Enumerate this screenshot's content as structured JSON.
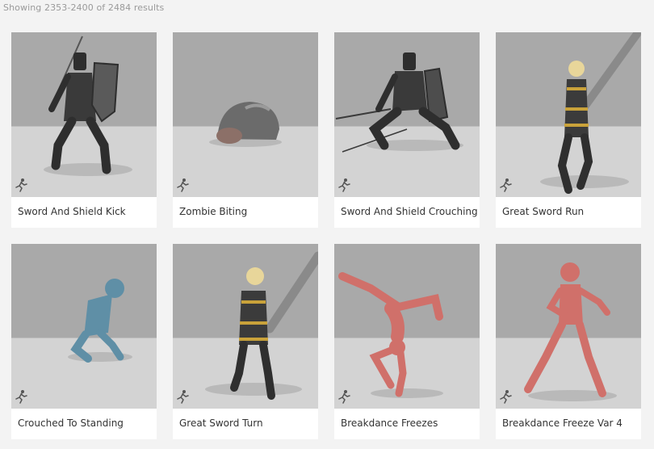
{
  "results": {
    "summary": "Showing 2353-2400 of 2484 results"
  },
  "cards": [
    {
      "title": "Sword And Shield Kick",
      "character": "knight"
    },
    {
      "title": "Zombie Biting",
      "character": "zombie"
    },
    {
      "title": "Sword And Shield Crouching",
      "character": "knight"
    },
    {
      "title": "Great Sword Run",
      "character": "paladin"
    },
    {
      "title": "Crouched To Standing",
      "character": "blue-mannequin"
    },
    {
      "title": "Great Sword Turn",
      "character": "paladin"
    },
    {
      "title": "Breakdance Freezes",
      "character": "red-mannequin"
    },
    {
      "title": "Breakdance Freeze Var 4",
      "character": "red-mannequin"
    }
  ],
  "colors": {
    "page_background": "#f3f3f3",
    "thumb_wall": "#a9a9a9",
    "thumb_floor": "#d3d3d3",
    "knight": "#2e2e2e",
    "paladin_gold": "#c9a23a",
    "blue_mannequin": "#5f8fa6",
    "red_mannequin": "#d0706a"
  }
}
